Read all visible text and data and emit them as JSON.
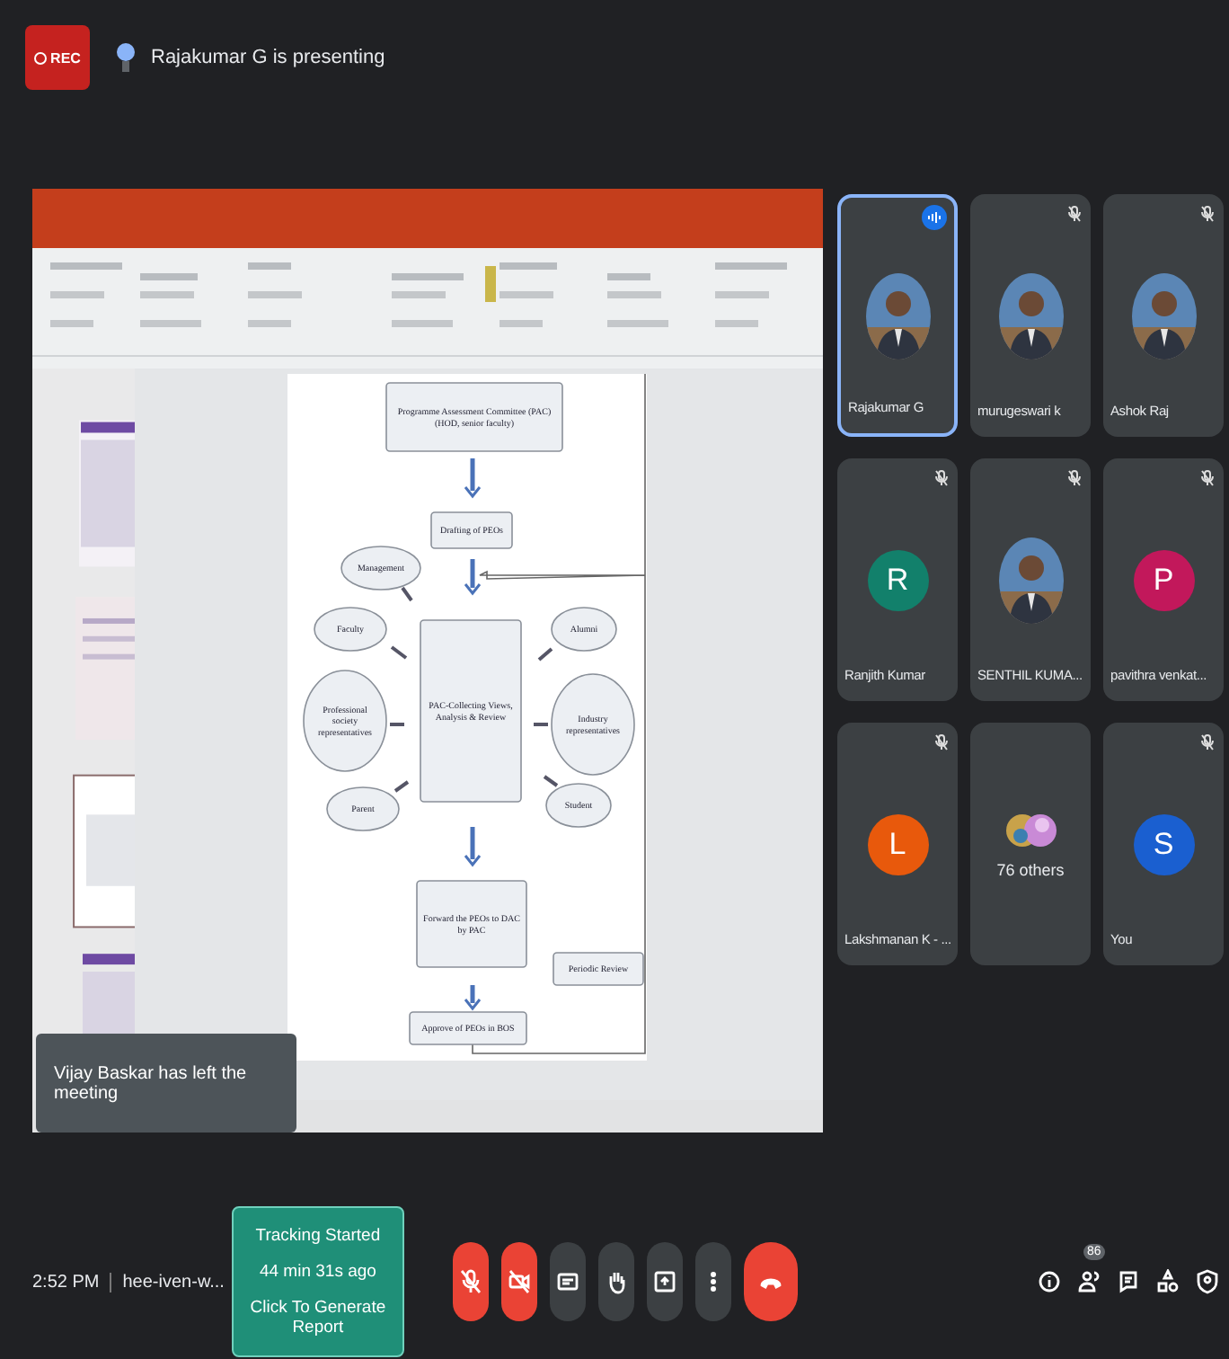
{
  "recording": {
    "label": "REC"
  },
  "presenter": {
    "text": "Rajakumar G is presenting"
  },
  "presentation": {
    "diagram": [
      {
        "kind": "box",
        "text": "Programme Assessment Committee (PAC)",
        "text2": "(HOD, senior faculty)"
      },
      {
        "kind": "box",
        "text": "Drafting of PEOs"
      },
      {
        "kind": "ellipse",
        "text": "Management"
      },
      {
        "kind": "ellipse",
        "text": "Faculty"
      },
      {
        "kind": "ellipse",
        "text": "Professional society representatives"
      },
      {
        "kind": "ellipse",
        "text": "Parent"
      },
      {
        "kind": "box",
        "text": "PAC-Collecting Views, Analysis & Review"
      },
      {
        "kind": "ellipse",
        "text": "Alumni"
      },
      {
        "kind": "ellipse",
        "text": "Industry representatives"
      },
      {
        "kind": "ellipse",
        "text": "Student"
      },
      {
        "kind": "box",
        "text": "Forward the PEOs to DAC by PAC"
      },
      {
        "kind": "box",
        "text": "Periodic Review"
      },
      {
        "kind": "box",
        "text": "Approve of PEOs in BOS"
      }
    ]
  },
  "toast": {
    "text": "Vijay Baskar has left the meeting"
  },
  "tiles": [
    {
      "name": "Rajakumar G",
      "muted": false,
      "speaking": true
    },
    {
      "name": "murugeswari k",
      "muted": true,
      "speaking": false
    },
    {
      "name": "Ashok Raj",
      "muted": true,
      "speaking": false
    },
    {
      "name": "Ranjith Kumar",
      "kind": "letter",
      "letter": "R",
      "color": "#12806b",
      "muted": true,
      "speaking": false
    },
    {
      "name": "SENTHIL KUMA...",
      "muted": true,
      "speaking": false
    },
    {
      "name": "pavithra venkat...",
      "kind": "letter",
      "letter": "P",
      "color": "#c2185b",
      "muted": true,
      "speaking": false
    },
    {
      "name": "Lakshmanan K - ...",
      "kind": "letter",
      "letter": "L",
      "color": "#e8590c",
      "muted": true,
      "speaking": false
    },
    {
      "name": "76 others",
      "kind": "group",
      "muted": false,
      "speaking": false
    },
    {
      "name": "You",
      "kind": "letter",
      "letter": "S",
      "color": "#1a5fd0",
      "muted": true,
      "speaking": false
    }
  ],
  "status": {
    "time": "2:52 PM",
    "meeting_code": "hee-iven-w..."
  },
  "tracking": {
    "lines": [
      "Tracking Started",
      "44 min 31s ago",
      "Click To Generate Report"
    ]
  },
  "controls": [
    {
      "kind": "mic",
      "off": true
    },
    {
      "kind": "camera",
      "off": true
    },
    {
      "kind": "captions",
      "off": false
    },
    {
      "kind": "hand",
      "off": false
    },
    {
      "kind": "present",
      "off": false
    },
    {
      "kind": "more",
      "off": false
    },
    {
      "kind": "end"
    }
  ],
  "side_icons": [
    {
      "kind": "info"
    },
    {
      "kind": "people",
      "badge": "86"
    },
    {
      "kind": "chat"
    },
    {
      "kind": "activities"
    },
    {
      "kind": "host"
    }
  ]
}
